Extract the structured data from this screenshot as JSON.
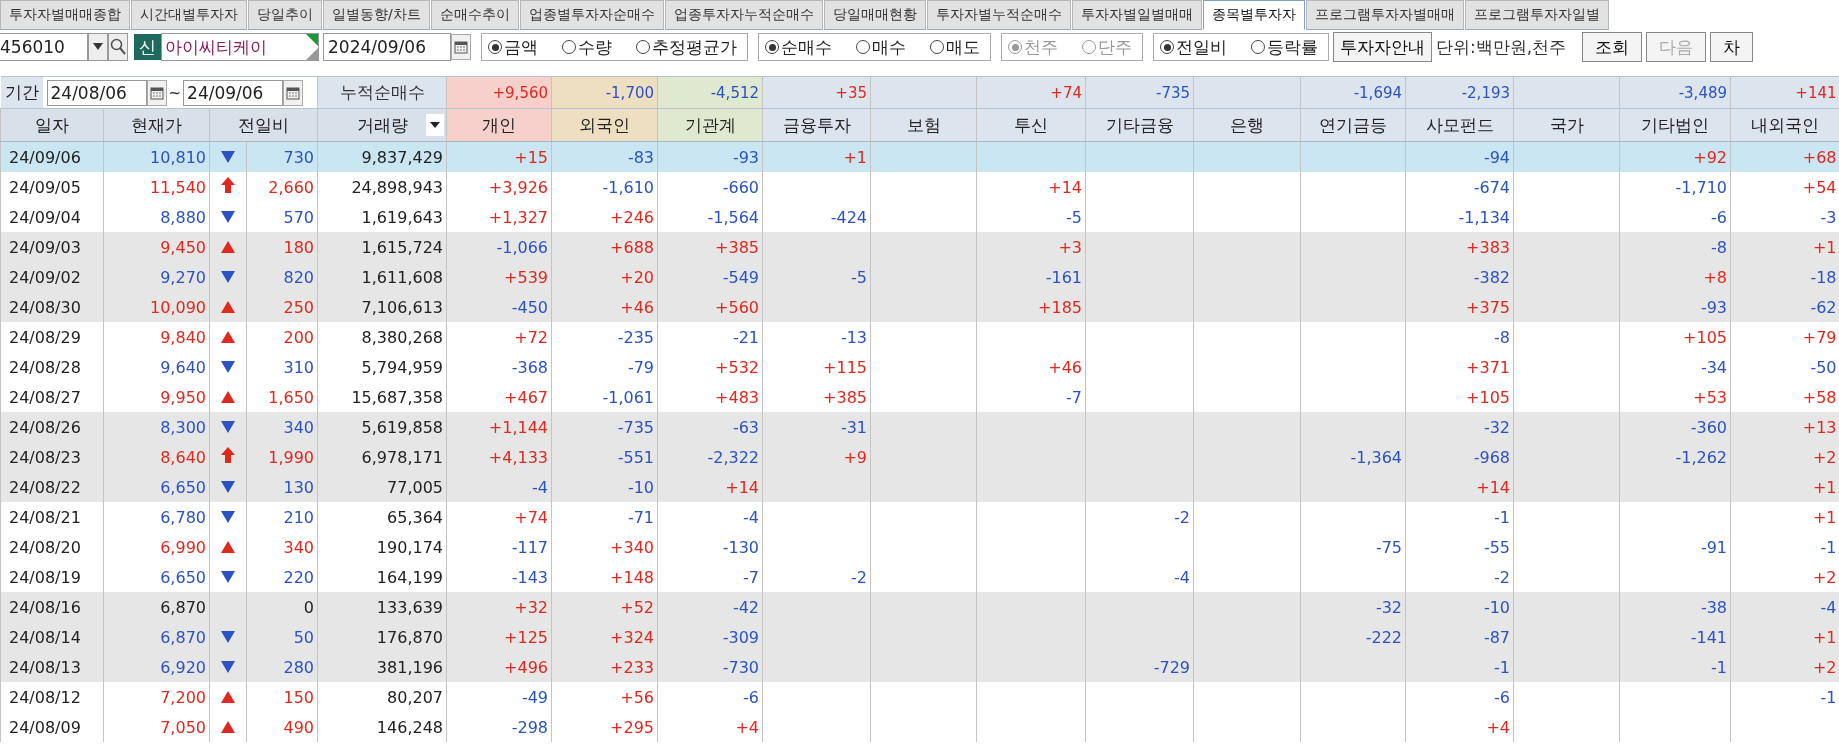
{
  "tabs": [
    {
      "label": "투자자별매매종합",
      "selected": false
    },
    {
      "label": "시간대별투자자",
      "selected": false
    },
    {
      "label": "당일추이",
      "selected": false
    },
    {
      "label": "일별동향/차트",
      "selected": false
    },
    {
      "label": "순매수추이",
      "selected": false
    },
    {
      "label": "업종별투자자순매수",
      "selected": false
    },
    {
      "label": "업종투자자누적순매수",
      "selected": false
    },
    {
      "label": "당일매매현황",
      "selected": false
    },
    {
      "label": "투자자별누적순매수",
      "selected": false
    },
    {
      "label": "투자자별일별매매",
      "selected": false
    },
    {
      "label": "종목별투자자",
      "selected": true
    },
    {
      "label": "프로그램투자자별매매",
      "selected": false
    },
    {
      "label": "프로그램투자자일별",
      "selected": false
    }
  ],
  "toolbar": {
    "code": "456010",
    "market_badge": "신",
    "stock_name": "아이씨티케이",
    "date": "2024/09/06",
    "radio_groups": [
      {
        "disabled": false,
        "options": [
          {
            "label": "금액",
            "selected": true
          },
          {
            "label": "수량",
            "selected": false
          },
          {
            "label": "추정평균가",
            "selected": false
          }
        ]
      },
      {
        "disabled": false,
        "options": [
          {
            "label": "순매수",
            "selected": true
          },
          {
            "label": "매수",
            "selected": false
          },
          {
            "label": "매도",
            "selected": false
          }
        ]
      },
      {
        "disabled": true,
        "options": [
          {
            "label": "천주",
            "selected": true
          },
          {
            "label": "단주",
            "selected": false
          }
        ]
      },
      {
        "disabled": false,
        "options": [
          {
            "label": "전일비",
            "selected": true
          },
          {
            "label": "등락률",
            "selected": false
          }
        ]
      }
    ],
    "guide_button": "투자자안내",
    "unit": "단위:백만원,천주",
    "buttons": [
      {
        "label": "조회",
        "disabled": false
      },
      {
        "label": "다음",
        "disabled": true
      },
      {
        "label": "차",
        "disabled": false
      }
    ]
  },
  "period": {
    "label": "기간",
    "from": "24/08/06",
    "separator": "~",
    "to": "24/09/06"
  },
  "cumulative_label": "누적순매수",
  "cumulative": {
    "individual": "+9,560",
    "foreign": "-1,700",
    "institution": "-4,512",
    "financial_investment": "+35",
    "investment_trust": "+74",
    "other_finance": "-735",
    "pension": "-1,694",
    "private_fund": "-2,193",
    "other_corp": "-3,489",
    "other_foreign": "+141"
  },
  "columns": [
    "일자",
    "현재가",
    "전일비",
    "거래량",
    "개인",
    "외국인",
    "기관계",
    "금융투자",
    "보험",
    "투신",
    "기타금융",
    "은행",
    "연기금등",
    "사모펀드",
    "국가",
    "기타법인",
    "내외국인"
  ],
  "rows": [
    {
      "date": "24/09/06",
      "price": "10,810",
      "kind": "down",
      "change": "730",
      "volume": "9,837,429",
      "selected": true,
      "investors": {
        "individual": "+15",
        "foreign": "-83",
        "institution": "-93",
        "financial_investment": "+1",
        "private_fund": "-94",
        "other_corp": "+92",
        "other_foreign": "+68"
      }
    },
    {
      "date": "24/09/05",
      "price": "11,540",
      "kind": "limit_up",
      "change": "2,660",
      "volume": "24,898,943",
      "selected": false,
      "investors": {
        "individual": "+3,926",
        "foreign": "-1,610",
        "institution": "-660",
        "investment_trust": "+14",
        "private_fund": "-674",
        "other_corp": "-1,710",
        "other_foreign": "+54"
      }
    },
    {
      "date": "24/09/04",
      "price": "8,880",
      "kind": "down",
      "change": "570",
      "volume": "1,619,643",
      "selected": false,
      "investors": {
        "individual": "+1,327",
        "foreign": "+246",
        "institution": "-1,564",
        "financial_investment": "-424",
        "investment_trust": "-5",
        "private_fund": "-1,134",
        "other_corp": "-6",
        "other_foreign": "-3"
      }
    },
    {
      "date": "24/09/03",
      "price": "9,450",
      "kind": "up",
      "change": "180",
      "volume": "1,615,724",
      "selected": false,
      "investors": {
        "individual": "-1,066",
        "foreign": "+688",
        "institution": "+385",
        "investment_trust": "+3",
        "private_fund": "+383",
        "other_corp": "-8",
        "other_foreign": "+1"
      }
    },
    {
      "date": "24/09/02",
      "price": "9,270",
      "kind": "down",
      "change": "820",
      "volume": "1,611,608",
      "selected": false,
      "investors": {
        "individual": "+539",
        "foreign": "+20",
        "institution": "-549",
        "financial_investment": "-5",
        "investment_trust": "-161",
        "private_fund": "-382",
        "other_corp": "+8",
        "other_foreign": "-18"
      }
    },
    {
      "date": "24/08/30",
      "price": "10,090",
      "kind": "up",
      "change": "250",
      "volume": "7,106,613",
      "selected": false,
      "investors": {
        "individual": "-450",
        "foreign": "+46",
        "institution": "+560",
        "investment_trust": "+185",
        "private_fund": "+375",
        "other_corp": "-93",
        "other_foreign": "-62"
      }
    },
    {
      "date": "24/08/29",
      "price": "9,840",
      "kind": "up",
      "change": "200",
      "volume": "8,380,268",
      "selected": false,
      "investors": {
        "individual": "+72",
        "foreign": "-235",
        "institution": "-21",
        "financial_investment": "-13",
        "private_fund": "-8",
        "other_corp": "+105",
        "other_foreign": "+79"
      }
    },
    {
      "date": "24/08/28",
      "price": "9,640",
      "kind": "down",
      "change": "310",
      "volume": "5,794,959",
      "selected": false,
      "investors": {
        "individual": "-368",
        "foreign": "-79",
        "institution": "+532",
        "financial_investment": "+115",
        "investment_trust": "+46",
        "private_fund": "+371",
        "other_corp": "-34",
        "other_foreign": "-50"
      }
    },
    {
      "date": "24/08/27",
      "price": "9,950",
      "kind": "up",
      "change": "1,650",
      "volume": "15,687,358",
      "selected": false,
      "investors": {
        "individual": "+467",
        "foreign": "-1,061",
        "institution": "+483",
        "financial_investment": "+385",
        "investment_trust": "-7",
        "private_fund": "+105",
        "other_corp": "+53",
        "other_foreign": "+58"
      }
    },
    {
      "date": "24/08/26",
      "price": "8,300",
      "kind": "down",
      "change": "340",
      "volume": "5,619,858",
      "selected": false,
      "investors": {
        "individual": "+1,144",
        "foreign": "-735",
        "institution": "-63",
        "financial_investment": "-31",
        "private_fund": "-32",
        "other_corp": "-360",
        "other_foreign": "+13"
      }
    },
    {
      "date": "24/08/23",
      "price": "8,640",
      "kind": "limit_up",
      "change": "1,990",
      "volume": "6,978,171",
      "selected": false,
      "investors": {
        "individual": "+4,133",
        "foreign": "-551",
        "institution": "-2,322",
        "financial_investment": "+9",
        "pension": "-1,364",
        "private_fund": "-968",
        "other_corp": "-1,262",
        "other_foreign": "+2"
      }
    },
    {
      "date": "24/08/22",
      "price": "6,650",
      "kind": "down",
      "change": "130",
      "volume": "77,005",
      "selected": false,
      "investors": {
        "individual": "-4",
        "foreign": "-10",
        "institution": "+14",
        "private_fund": "+14",
        "other_foreign": "+1"
      }
    },
    {
      "date": "24/08/21",
      "price": "6,780",
      "kind": "down",
      "change": "210",
      "volume": "65,364",
      "selected": false,
      "investors": {
        "individual": "+74",
        "foreign": "-71",
        "institution": "-4",
        "other_finance": "-2",
        "private_fund": "-1",
        "other_foreign": "+1"
      }
    },
    {
      "date": "24/08/20",
      "price": "6,990",
      "kind": "up",
      "change": "340",
      "volume": "190,174",
      "selected": false,
      "investors": {
        "individual": "-117",
        "foreign": "+340",
        "institution": "-130",
        "pension": "-75",
        "private_fund": "-55",
        "other_corp": "-91",
        "other_foreign": "-1"
      }
    },
    {
      "date": "24/08/19",
      "price": "6,650",
      "kind": "down",
      "change": "220",
      "volume": "164,199",
      "selected": false,
      "investors": {
        "individual": "-143",
        "foreign": "+148",
        "institution": "-7",
        "financial_investment": "-2",
        "other_finance": "-4",
        "private_fund": "-2",
        "other_foreign": "+2"
      }
    },
    {
      "date": "24/08/16",
      "price": "6,870",
      "kind": "flat",
      "change": "0",
      "volume": "133,639",
      "selected": false,
      "investors": {
        "individual": "+32",
        "foreign": "+52",
        "institution": "-42",
        "pension": "-32",
        "private_fund": "-10",
        "other_corp": "-38",
        "other_foreign": "-4"
      }
    },
    {
      "date": "24/08/14",
      "price": "6,870",
      "kind": "down",
      "change": "50",
      "volume": "176,870",
      "selected": false,
      "investors": {
        "individual": "+125",
        "foreign": "+324",
        "institution": "-309",
        "pension": "-222",
        "private_fund": "-87",
        "other_corp": "-141",
        "other_foreign": "+1"
      }
    },
    {
      "date": "24/08/13",
      "price": "6,920",
      "kind": "down",
      "change": "280",
      "volume": "381,196",
      "selected": false,
      "investors": {
        "individual": "+496",
        "foreign": "+233",
        "institution": "-730",
        "other_finance": "-729",
        "private_fund": "-1",
        "other_corp": "-1",
        "other_foreign": "+2"
      }
    },
    {
      "date": "24/08/12",
      "price": "7,200",
      "kind": "up",
      "change": "150",
      "volume": "80,207",
      "selected": false,
      "investors": {
        "individual": "-49",
        "foreign": "+56",
        "institution": "-6",
        "private_fund": "-6",
        "other_foreign": "-1"
      }
    },
    {
      "date": "24/08/09",
      "price": "7,050",
      "kind": "up",
      "change": "490",
      "volume": "146,248",
      "selected": false,
      "investors": {
        "individual": "-298",
        "foreign": "+295",
        "institution": "+4",
        "private_fund": "+4"
      }
    }
  ]
}
